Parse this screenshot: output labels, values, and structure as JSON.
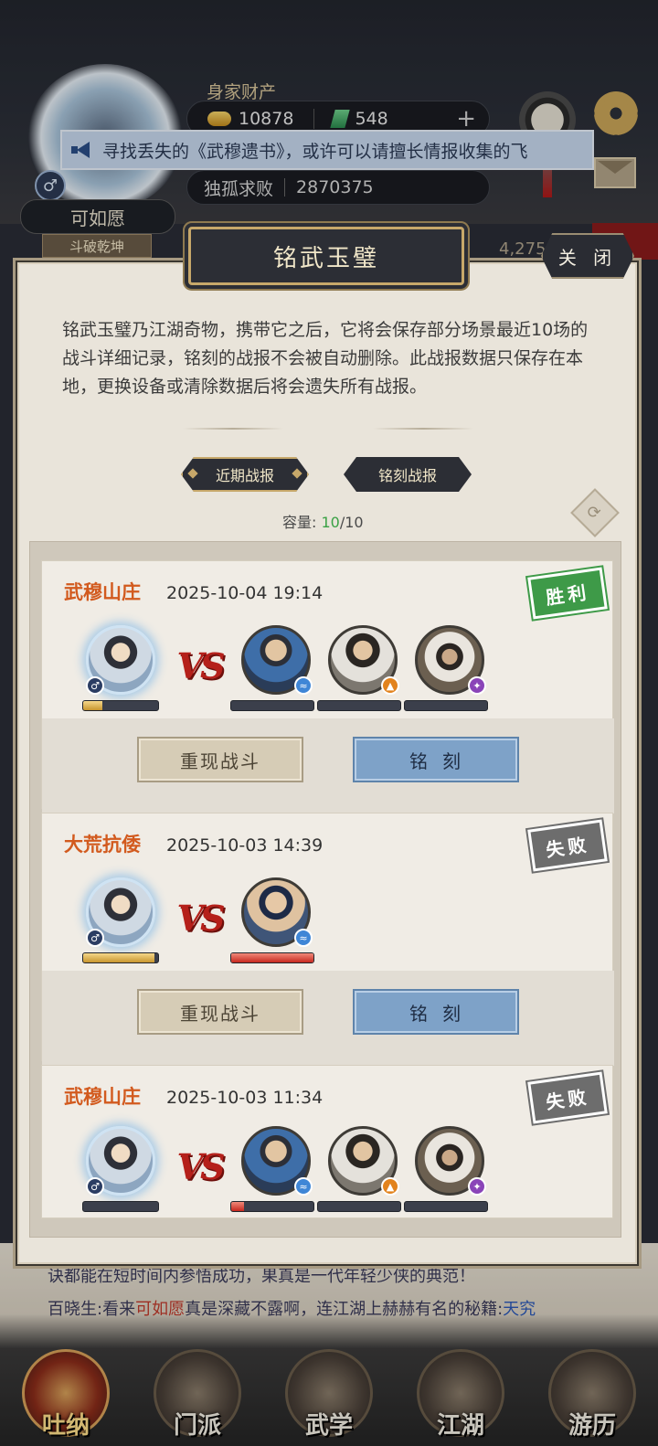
{
  "player": {
    "name": "可如愿",
    "sub_title": "斗破乾坤",
    "gender_symbol": "♂",
    "wealth_label": "身家财产",
    "gold": "10878",
    "jade": "548",
    "rank_title": "独孤求败",
    "rank_score": "2870375"
  },
  "marquee": {
    "text": "寻找丢失的《武穆遗书》，或许可以请擅长情报收集的飞"
  },
  "background_counter": "4,275",
  "modal": {
    "title": "铭武玉璧",
    "close_label": "关 闭",
    "description": "铭武玉璧乃江湖奇物，携带它之后，它将会保存部分场景最近10场的战斗详细记录，铭刻的战报不会被自动删除。此战报数据只保存在本地，更换设备或清除数据后将会遗失所有战报。",
    "tabs": [
      {
        "label": "近期战报",
        "selected": true
      },
      {
        "label": "铭刻战报",
        "selected": false
      }
    ],
    "capacity_label": "容量:",
    "capacity_used": "10",
    "capacity_total": "/10",
    "refresh_icon": "refresh-icon"
  },
  "battles": [
    {
      "location": "武穆山庄",
      "time": "2025-10-04 19:14",
      "result": "胜利",
      "result_type": "win",
      "self_hp_fraction": 0.25,
      "enemies": [
        {
          "portrait": "blue",
          "element": "water",
          "hp_fraction": 0.0
        },
        {
          "portrait": "white",
          "element": "fire",
          "hp_fraction": 0.0
        },
        {
          "portrait": "fur",
          "element": "poison",
          "hp_fraction": 0.0
        }
      ],
      "replay_label": "重现战斗",
      "engrave_label": "铭刻"
    },
    {
      "location": "大荒抗倭",
      "time": "2025-10-03 14:39",
      "result": "失败",
      "result_type": "lose",
      "self_hp_fraction": 0.95,
      "enemies": [
        {
          "portrait": "bare",
          "element": "water",
          "hp_fraction": 1.0
        }
      ],
      "replay_label": "重现战斗",
      "engrave_label": "铭刻"
    },
    {
      "location": "武穆山庄",
      "time": "2025-10-03 11:34",
      "result": "失败",
      "result_type": "lose",
      "self_hp_fraction": 0.0,
      "enemies": [
        {
          "portrait": "blue",
          "element": "water",
          "hp_fraction": 0.15
        },
        {
          "portrait": "white",
          "element": "fire",
          "hp_fraction": 0.0
        },
        {
          "portrait": "fur",
          "element": "poison",
          "hp_fraction": 0.0
        }
      ]
    }
  ],
  "chat": {
    "line1": "诀都能在短时间内参悟成功，果真是一代年轻少侠的典范！",
    "line2_prefix": "百晓生:看来",
    "line2_name": "可如愿",
    "line2_mid": "真是深藏不露啊，连江湖上赫赫有名的秘籍:",
    "line2_link": "天究"
  },
  "navbar": [
    {
      "label": "吐纳",
      "active": true
    },
    {
      "label": "门派",
      "active": false
    },
    {
      "label": "武学",
      "active": false
    },
    {
      "label": "江湖",
      "active": false
    },
    {
      "label": "游历",
      "active": false
    }
  ],
  "vs_text": "VS",
  "colors": {
    "win": "#3e9a48",
    "lose": "#6d6d6d",
    "location": "#d25a1e",
    "engrave_button": "#7ea2c8"
  }
}
